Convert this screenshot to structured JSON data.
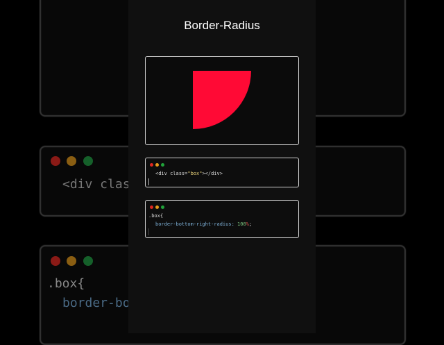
{
  "title": "Border-Radius",
  "html_code": {
    "open": "<div class=",
    "attr": "\"box\"",
    "close": "></div>"
  },
  "css_code": {
    "selector": ".box{",
    "property": "border-bottom-right-radius:",
    "value": "100",
    "unit": "%",
    "end": ";"
  },
  "background": {
    "html_fragment": "<div clas",
    "css_selector": ".box{",
    "css_fragment": "border-bo"
  },
  "colors": {
    "shape": "#ff0a35",
    "dot_red": "#e0271f",
    "dot_yellow": "#e69a1b",
    "dot_green": "#21a33a",
    "property": "#7fb2d9",
    "value": "#7cc47f",
    "string": "#e8d27a"
  }
}
